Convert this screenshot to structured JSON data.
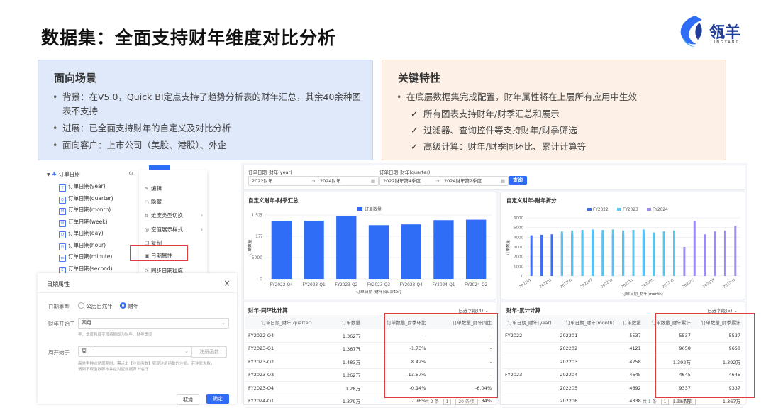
{
  "title": "数据集：全面支持财年维度对比分析",
  "logo": {
    "name": "瓴羊",
    "sub": "LINGYANG"
  },
  "left_card": {
    "heading": "面向场景",
    "items": [
      "背景：在V5.0，Quick BI定点支持了趋势分析表的财年汇总，其余40余种图表不支持",
      "进展：已全面支持财年的自定义及对比分析",
      "面向客户：上市公司（美股、港股）、外企"
    ]
  },
  "right_card": {
    "heading": "关键特性",
    "items": [
      "在底层数据集完成配置，财年属性将在上层所有应用中生效"
    ],
    "checks": [
      "所有图表支持财年/财季汇总和展示",
      "过滤器、查询控件等支持财年/财季筛选",
      "高级计算：财年/财季同环比、累计计算等"
    ]
  },
  "tree": {
    "root": "订单日期",
    "items": [
      "订单日期(year)",
      "订单日期(quarter)",
      "订单日期(month)",
      "订单日期(week)",
      "订单日期(day)",
      "订单日期(hour)",
      "订单日期(minute)",
      "订单日期(second)"
    ]
  },
  "context_menu": {
    "top_tag": "维度",
    "items": [
      {
        "label": "编辑",
        "icon": "edit-icon",
        "glyph": "✎"
      },
      {
        "label": "隐藏",
        "icon": "hide-icon",
        "glyph": "◌"
      },
      {
        "label": "维度类型切换",
        "icon": "switch-icon",
        "glyph": "⇅",
        "sub": true
      },
      {
        "label": "空值展示样式",
        "icon": "null-style-icon",
        "glyph": "◎",
        "sub": true
      },
      {
        "label": "复制",
        "icon": "copy-icon",
        "glyph": "❐"
      },
      {
        "label": "日期属性",
        "icon": "calendar-icon",
        "glyph": "▣"
      },
      {
        "label": "同步日期粒度",
        "icon": "sync-icon",
        "glyph": "⟳"
      }
    ]
  },
  "dialog": {
    "title": "日期属性",
    "close": "×",
    "date_type_label": "日期类型",
    "option_natural": "公历自然年",
    "option_fiscal": "财年",
    "fiscal_start_label": "财年开始于",
    "fiscal_start_value": "四月",
    "fiscal_hint": "年、季度和度字段将随即为财年、财年季度",
    "week_start_label": "周开始于",
    "week_start_value": "周一",
    "register_fn": "注册函数",
    "week_hint_1": "高类型种以然周期时，需点击【注册函数】实现注册函数的注册。若注册失败，",
    "week_hint_2": "请到下载函数脚本并在对应数据源上运行",
    "cancel": "取消",
    "confirm": "确定"
  },
  "query_bar": {
    "label1": "订单日期_财年(year)",
    "from1": "2022财年",
    "to1": "2024财年",
    "label2": "订单日期_财年(quarter)",
    "from2": "2022财年第4季度",
    "to2": "2024财年第2季度",
    "query_btn": "查询",
    "arrow": "→"
  },
  "bar_chart": {
    "title": "自定义财年-财季汇总",
    "legend": "订单数量",
    "ylabel": "订单数量",
    "xlabel": "订单日期_财年(quarter)",
    "yticks": [
      "1.5万",
      "1万",
      "5000",
      "0"
    ]
  },
  "group_chart": {
    "title": "自定义财年-财年拆分",
    "ylabel": "订单数量",
    "xlabel": "订单日期_财年(month)",
    "yticks": [
      "6000",
      "5000",
      "4000",
      "3000",
      "2000",
      "1000",
      "0"
    ],
    "xticks": [
      "202201",
      "202203",
      "202205",
      "202207",
      "202209",
      "202211",
      "202301",
      "202303",
      "202305",
      "202307",
      "202309"
    ]
  },
  "chart_data": [
    {
      "type": "bar",
      "title": "自定义财年-财季汇总",
      "categories": [
        "FY2022-Q4",
        "FY2023-Q1",
        "FY2023-Q2",
        "FY2023-Q3",
        "FY2023-Q4",
        "FY2024-Q1",
        "FY2024-Q2"
      ],
      "series": [
        {
          "name": "订单数量",
          "values": [
            13620,
            13670,
            14830,
            12620,
            12800,
            13790,
            13900
          ]
        }
      ],
      "xlabel": "订单日期_财年(quarter)",
      "ylabel": "订单数量",
      "ylim": [
        0,
        15000
      ],
      "color": "#2f6df6"
    },
    {
      "type": "bar",
      "title": "自定义财年-财年拆分",
      "categories": [
        "202201",
        "202202",
        "202203",
        "202204",
        "202205",
        "202206",
        "202207",
        "202208",
        "202209",
        "202210",
        "202211",
        "202212",
        "202301",
        "202302",
        "202303",
        "202304",
        "202305",
        "202306",
        "202307",
        "202308",
        "202309"
      ],
      "series": [
        {
          "name": "FY2022",
          "values": [
            4200,
            4250,
            4300,
            4350,
            4300,
            4400,
            4300,
            4450,
            4300,
            4350,
            4300,
            4400,
            null,
            null,
            null,
            null,
            null,
            null,
            null,
            null,
            null
          ],
          "color": "#3e6df2"
        },
        {
          "name": "FY2023",
          "values": [
            null,
            null,
            null,
            4600,
            4700,
            4750,
            4800,
            4750,
            4800,
            4700,
            4750,
            4800,
            4500,
            4600,
            4700,
            null,
            null,
            null,
            null,
            null,
            null
          ],
          "color": "#55c6f0"
        },
        {
          "name": "FY2024",
          "values": [
            null,
            null,
            null,
            null,
            null,
            null,
            null,
            null,
            null,
            null,
            null,
            null,
            null,
            null,
            null,
            3000,
            5700,
            4300,
            4600,
            4700,
            5200
          ],
          "color": "#9d8cf2"
        }
      ],
      "xlabel": "订单日期_财年(month)",
      "ylabel": "订单数量",
      "ylim": [
        0,
        6000
      ]
    }
  ],
  "yoy_table": {
    "title": "财年-同环比计算",
    "fields": "已选字段(4)",
    "headers": [
      "订单日期_财年(quarter)",
      "订单数量",
      "订单数量_财季环比",
      "订单数量_财年同比"
    ],
    "rows": [
      [
        "FY2022-Q4",
        "1.362万",
        "-",
        "-"
      ],
      [
        "FY2023-Q1",
        "1.367万",
        "-1.73%",
        "-"
      ],
      [
        "FY2023-Q2",
        "1.483万",
        "8.42%",
        "-"
      ],
      [
        "FY2023-Q3",
        "1.262万",
        "-13.57%",
        "-"
      ],
      [
        "FY2023-Q4",
        "1.28万",
        "-0.14%",
        "-6.04%"
      ],
      [
        "FY2024-Q1",
        "1.379万",
        "7.76%",
        "0.84%"
      ]
    ],
    "pager": "共 2 条",
    "page": "1",
    "size": "20 条/页"
  },
  "cum_table": {
    "title": "财年-累计计算",
    "fields": "已选字段(5)",
    "headers": [
      "订单日期_财年(year)",
      "订单日期_财年(month)",
      "订单数量",
      "订单数量_财年累计",
      "订单数量_财季累计"
    ],
    "rows": [
      [
        "FY2022",
        "202201",
        "5537",
        "5537",
        "5537"
      ],
      [
        "",
        "202202",
        "4121",
        "9658",
        "9658"
      ],
      [
        "",
        "202203",
        "4258",
        "1.392万",
        "1.392万"
      ],
      [
        "FY2023",
        "202204",
        "4645",
        "4645",
        "4645"
      ],
      [
        "",
        "202205",
        "4692",
        "9337",
        "9337"
      ],
      [
        "",
        "202206",
        "4338",
        "1.367万",
        "1.367万"
      ]
    ],
    "pager": "共 1 条",
    "page": "1",
    "size": "20 条/页"
  }
}
